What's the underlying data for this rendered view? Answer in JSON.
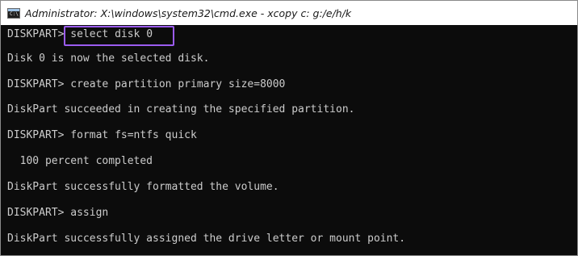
{
  "window": {
    "title": "Administrator: X:\\windows\\system32\\cmd.exe - xcopy  c: g:/e/h/k",
    "icon": "cmd-icon",
    "icon_label": "C:\\"
  },
  "console": {
    "lines": [
      {
        "prompt": "DISKPART> ",
        "command": "select disk 0"
      },
      {
        "text": "Disk 0 is now the selected disk."
      },
      {
        "prompt": "DISKPART> ",
        "command": "create partition primary size=8000"
      },
      {
        "text": "DiskPart succeeded in creating the specified partition."
      },
      {
        "prompt": "DISKPART> ",
        "command": "format fs=ntfs quick"
      },
      {
        "text": "  100 percent completed"
      },
      {
        "text": "DiskPart successfully formatted the volume."
      },
      {
        "prompt": "DISKPART> ",
        "command": "assign"
      },
      {
        "text": "DiskPart successfully assigned the drive letter or mount point."
      }
    ]
  },
  "colors": {
    "console_bg": "#0c0c0c",
    "console_text": "#cccccc",
    "highlight": "#9b5cf0"
  }
}
